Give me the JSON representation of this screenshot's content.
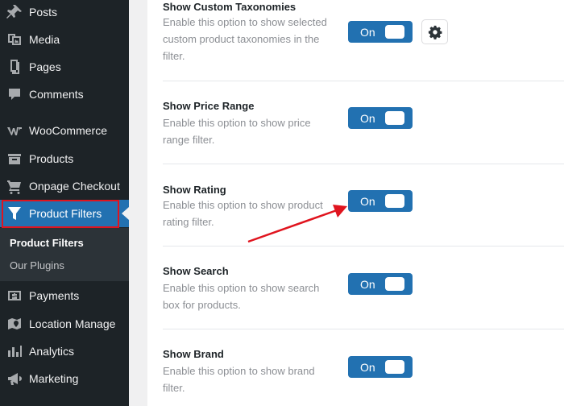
{
  "sidebar": {
    "items": [
      {
        "label": "Posts",
        "icon": "pin-icon"
      },
      {
        "label": "Media",
        "icon": "media-icon"
      },
      {
        "label": "Pages",
        "icon": "pages-icon"
      },
      {
        "label": "Comments",
        "icon": "comments-icon"
      },
      {
        "label": "WooCommerce",
        "icon": "woocommerce-icon"
      },
      {
        "label": "Products",
        "icon": "products-icon"
      },
      {
        "label": "Onpage Checkout",
        "icon": "cart-icon"
      },
      {
        "label": "Product Filters",
        "icon": "filter-icon"
      },
      {
        "label": "Payments",
        "icon": "payments-icon"
      },
      {
        "label": "Location Manage",
        "icon": "location-icon"
      },
      {
        "label": "Analytics",
        "icon": "analytics-icon"
      },
      {
        "label": "Marketing",
        "icon": "megaphone-icon"
      }
    ],
    "submenu": [
      "Product Filters",
      "Our Plugins"
    ]
  },
  "settings": [
    {
      "title": "Show Custom Taxonomies",
      "desc": "Enable this option to show selected custom product taxonomies in the filter.",
      "toggle": "On"
    },
    {
      "title": "Show Price Range",
      "desc": "Enable this option to show price range filter.",
      "toggle": "On"
    },
    {
      "title": "Show Rating",
      "desc": "Enable this option to show product rating filter.",
      "toggle": "On"
    },
    {
      "title": "Show Search",
      "desc": "Enable this option to show search box for products.",
      "toggle": "On"
    },
    {
      "title": "Show Brand",
      "desc": "Enable this option to show brand filter.",
      "toggle": "On"
    }
  ],
  "colors": {
    "sidebar": "#1d2327",
    "accent": "#2271b1",
    "highlight": "#e0141e"
  }
}
